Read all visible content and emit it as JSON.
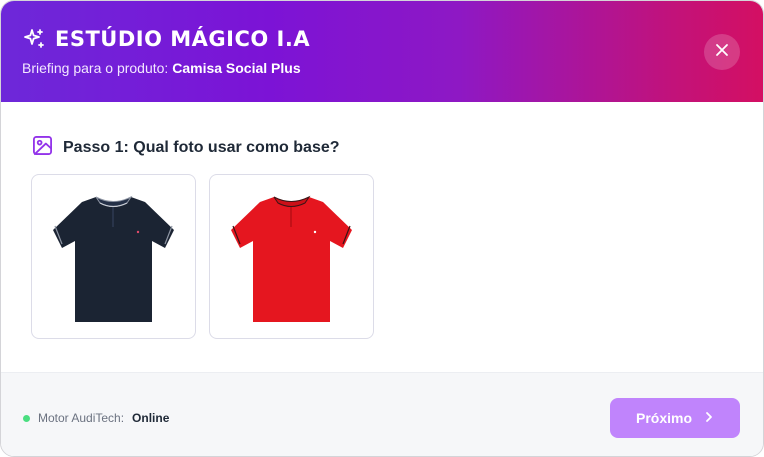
{
  "header": {
    "title": "ESTÚDIO MÁGICO I.A",
    "subtitle_prefix": "Briefing para o produto:",
    "product_name": "Camisa Social Plus",
    "close_icon": "close-icon",
    "title_icon": "sparkles-icon"
  },
  "step": {
    "icon": "image-icon",
    "title": "Passo 1: Qual foto usar como base?"
  },
  "photos": [
    {
      "name": "navy-polo-shirt",
      "color": "#1b2433"
    },
    {
      "name": "red-polo-shirt",
      "color": "#e5161f"
    }
  ],
  "footer": {
    "status_label": "Motor AudiTech:",
    "status_value": "Online",
    "status_color": "#4ade80",
    "next_label": "Próximo",
    "next_icon": "chevron-right-icon"
  },
  "colors": {
    "accent": "#7c13d6",
    "gradient_end": "#d40f62",
    "button": "#c084fc"
  }
}
